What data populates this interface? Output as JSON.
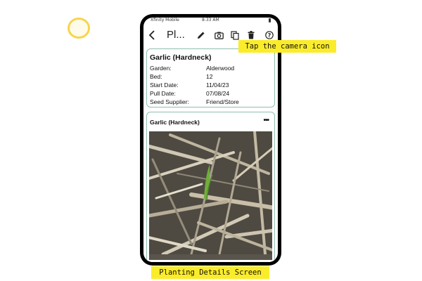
{
  "status_bar": {
    "carrier": "Xfinity Mobile",
    "time": "8:33 AM"
  },
  "toolbar": {
    "title_truncated": "Pl...",
    "icons": [
      "back-icon",
      "pencil-icon",
      "camera-icon",
      "copy-icon",
      "trash-icon",
      "help-icon"
    ]
  },
  "details_card": {
    "title": "Garlic (Hardneck)",
    "rows": [
      {
        "label": "Garden:",
        "value": "Alderwood"
      },
      {
        "label": "Bed:",
        "value": "12"
      },
      {
        "label": "Start Date:",
        "value": "11/04/23"
      },
      {
        "label": "Pull Date:",
        "value": "07/08/24"
      },
      {
        "label": "Seed Supplier:",
        "value": "Friend/Store"
      }
    ]
  },
  "photo_card": {
    "title": "Garlic (Hardneck)",
    "menu": "•••"
  },
  "callout": "Tap the camera icon",
  "caption": "Planting Details Screen",
  "colors": {
    "highlight": "#fbec2b",
    "card_border": "#8fbfae",
    "ring": "#f7d54a"
  }
}
